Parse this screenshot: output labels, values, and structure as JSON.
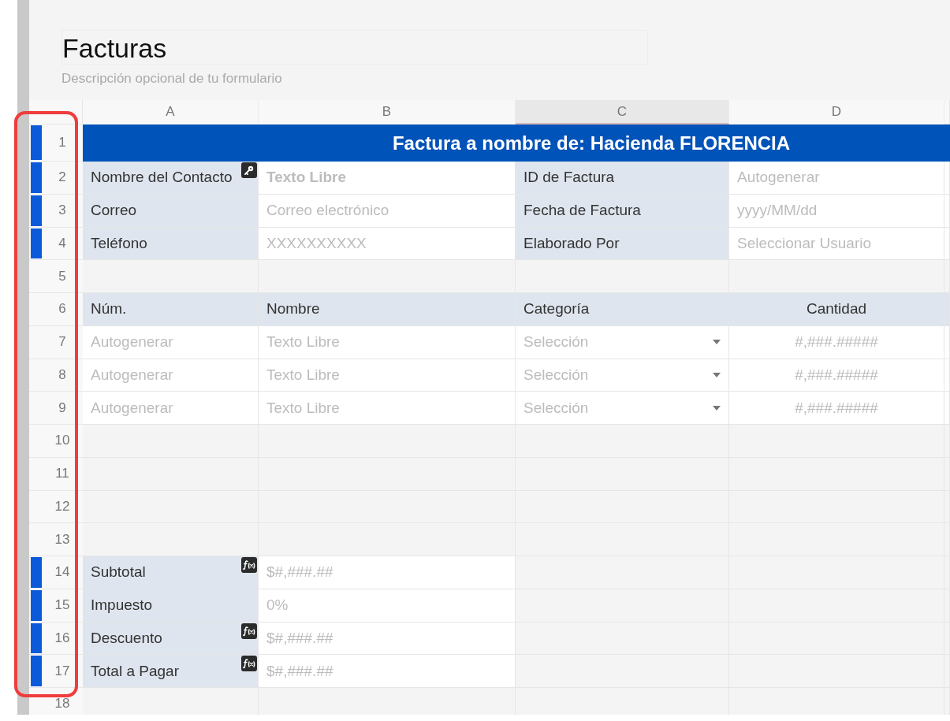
{
  "form": {
    "title": "Facturas",
    "description": "Descripción opcional de tu formulario"
  },
  "columns": [
    {
      "label": "A",
      "selected": false
    },
    {
      "label": "B",
      "selected": false
    },
    {
      "label": "C",
      "selected": true
    },
    {
      "label": "D",
      "selected": false
    }
  ],
  "rows": [
    {
      "number": "1",
      "marked": true,
      "kind": "banner",
      "text": "Factura a nombre de: Hacienda FLORENCIA"
    },
    {
      "number": "2",
      "marked": true,
      "kind": "fields",
      "cells": [
        {
          "label": "Nombre del Contacto",
          "key_field": true
        },
        {
          "value": "Texto Libre",
          "bold": true
        },
        {
          "label": "ID de Factura"
        },
        {
          "value": "Autogenerar"
        }
      ]
    },
    {
      "number": "3",
      "marked": true,
      "kind": "fields",
      "cells": [
        {
          "label": "Correo",
          "key_field": false
        },
        {
          "value": "Correo electrónico",
          "bold": false
        },
        {
          "label": "Fecha de Factura"
        },
        {
          "value": "yyyy/MM/dd"
        }
      ]
    },
    {
      "number": "4",
      "marked": true,
      "kind": "fields",
      "cells": [
        {
          "label": "Teléfono",
          "key_field": false
        },
        {
          "value": "XXXXXXXXXX",
          "bold": false
        },
        {
          "label": "Elaborado Por"
        },
        {
          "value": "Seleccionar Usuario"
        }
      ]
    },
    {
      "number": "5",
      "marked": false,
      "kind": "empty"
    },
    {
      "number": "6",
      "marked": false,
      "kind": "header",
      "cells": [
        "Núm.",
        "Nombre",
        "Categoría",
        "Cantidad"
      ]
    },
    {
      "number": "7",
      "marked": false,
      "kind": "item",
      "cells": [
        "Autogenerar",
        "Texto Libre",
        "Selección",
        "#,###.#####"
      ]
    },
    {
      "number": "8",
      "marked": false,
      "kind": "item",
      "cells": [
        "Autogenerar",
        "Texto Libre",
        "Selección",
        "#,###.#####"
      ]
    },
    {
      "number": "9",
      "marked": false,
      "kind": "item",
      "cells": [
        "Autogenerar",
        "Texto Libre",
        "Selección",
        "#,###.#####"
      ]
    },
    {
      "number": "10",
      "marked": false,
      "kind": "empty"
    },
    {
      "number": "11",
      "marked": false,
      "kind": "empty"
    },
    {
      "number": "12",
      "marked": false,
      "kind": "empty"
    },
    {
      "number": "13",
      "marked": false,
      "kind": "empty"
    },
    {
      "number": "14",
      "marked": true,
      "kind": "total",
      "label": "Subtotal",
      "formula": true,
      "value": "$#,###.##"
    },
    {
      "number": "15",
      "marked": true,
      "kind": "total",
      "label": "Impuesto",
      "formula": false,
      "value": "0%"
    },
    {
      "number": "16",
      "marked": true,
      "kind": "total",
      "label": "Descuento",
      "formula": true,
      "value": "$#,###.##"
    },
    {
      "number": "17",
      "marked": true,
      "kind": "total",
      "label": "Total a Pagar",
      "formula": true,
      "value": "$#,###.##"
    },
    {
      "number": "18",
      "marked": false,
      "kind": "empty"
    }
  ]
}
